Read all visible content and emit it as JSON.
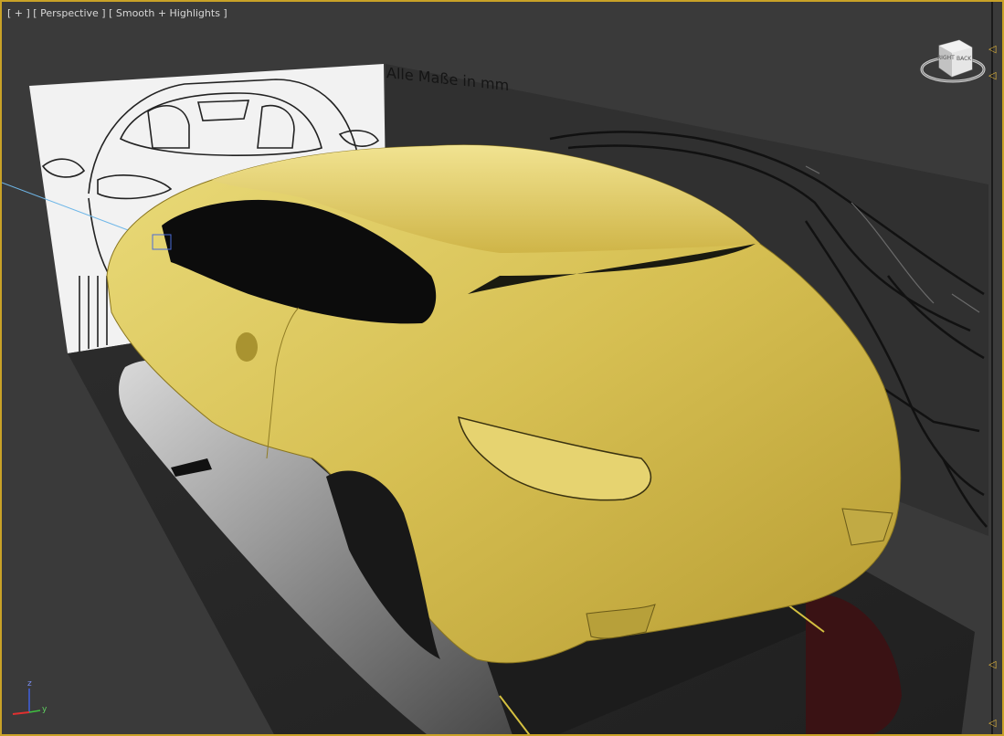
{
  "viewport": {
    "label_menu": "[ + ]",
    "label_view": "[ Perspective ]",
    "label_shading": "[ Smooth + Highlights ]",
    "active_border_color": "#c9a227"
  },
  "reference_text": "Alle Maße in mm",
  "nav_cube": {
    "icon": "viewcube-icon",
    "face_left": "RIGHT",
    "face_front": "BACK"
  },
  "axis_gizmo": {
    "z_label": "z",
    "y_label": "y",
    "x_color": "#e03030",
    "y_color": "#40c040",
    "z_color": "#4060e0"
  },
  "model_color": "#d9c25a"
}
